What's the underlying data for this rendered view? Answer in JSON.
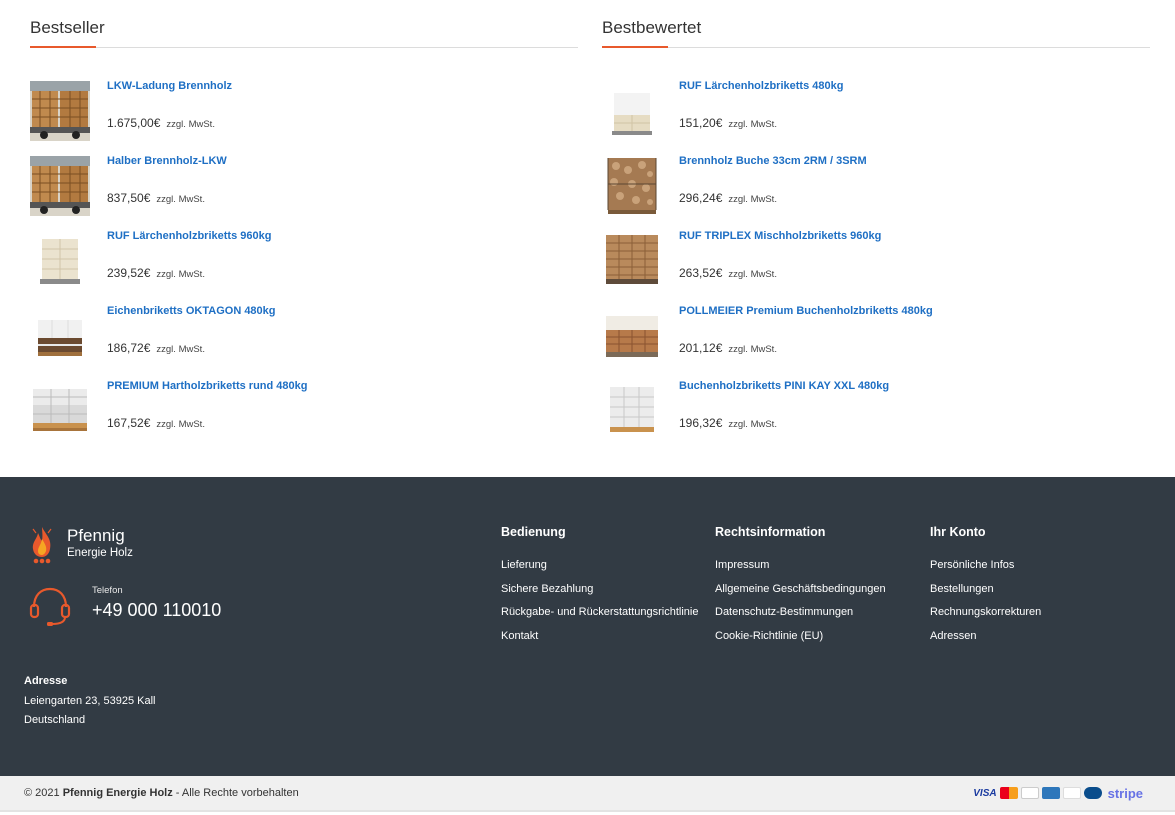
{
  "bestseller": {
    "title": "Bestseller",
    "items": [
      {
        "name": "LKW-Ladung Brennholz",
        "price": "1.675,00€",
        "tax": "zzgl. MwSt."
      },
      {
        "name": "Halber Brennholz-LKW",
        "price": "837,50€",
        "tax": "zzgl. MwSt."
      },
      {
        "name": "RUF Lärchenholzbriketts 960kg",
        "price": "239,52€",
        "tax": "zzgl. MwSt."
      },
      {
        "name": "Eichenbriketts OKTAGON 480kg",
        "price": "186,72€",
        "tax": "zzgl. MwSt."
      },
      {
        "name": "PREMIUM Hartholzbriketts rund 480kg",
        "price": "167,52€",
        "tax": "zzgl. MwSt."
      }
    ]
  },
  "bestbewertet": {
    "title": "Bestbewertet",
    "items": [
      {
        "name": "RUF Lärchenholzbriketts 480kg",
        "price": "151,20€",
        "tax": "zzgl. MwSt."
      },
      {
        "name": "Brennholz Buche 33cm 2RM / 3SRM",
        "price": "296,24€",
        "tax": "zzgl. MwSt."
      },
      {
        "name": "RUF TRIPLEX Mischholzbriketts 960kg",
        "price": "263,52€",
        "tax": "zzgl. MwSt."
      },
      {
        "name": "POLLMEIER Premium Buchenholzbriketts 480kg",
        "price": "201,12€",
        "tax": "zzgl. MwSt."
      },
      {
        "name": "Buchenholzbriketts PINI KAY XXL 480kg",
        "price": "196,32€",
        "tax": "zzgl. MwSt."
      }
    ]
  },
  "footer": {
    "logo_line1": "Pfennig",
    "logo_line2": "Energie Holz",
    "phone_label": "Telefon",
    "phone_number": "+49 000 110010",
    "address_title": "Adresse",
    "address_line1": "Leiengarten 23, 53925 Kall",
    "address_line2": "Deutschland",
    "columns": [
      {
        "title": "Bedienung",
        "links": [
          "Lieferung",
          "Sichere Bezahlung",
          "Rückgabe- und Rückerstattungsrichtlinie",
          "Kontakt"
        ]
      },
      {
        "title": "Rechtsinformation",
        "links": [
          "Impressum",
          "Allgemeine Geschäftsbedingungen",
          "Datenschutz-Bestimmungen",
          "Cookie-Richtlinie (EU)"
        ]
      },
      {
        "title": "Ihr Konto",
        "links": [
          "Persönliche Infos",
          "Bestellungen",
          "Rechnungskorrekturen",
          "Adressen"
        ]
      }
    ]
  },
  "bottom": {
    "copyright_prefix": "© 2021",
    "brand": "Pfennig Energie Holz",
    "copyright_suffix": "- Alle Rechte vorbehalten",
    "payment_visa": "VISA",
    "payment_stripe": "stripe"
  },
  "colors": {
    "accent": "#e8592c",
    "link": "#1e6fc4",
    "footer_bg": "#323b44"
  }
}
